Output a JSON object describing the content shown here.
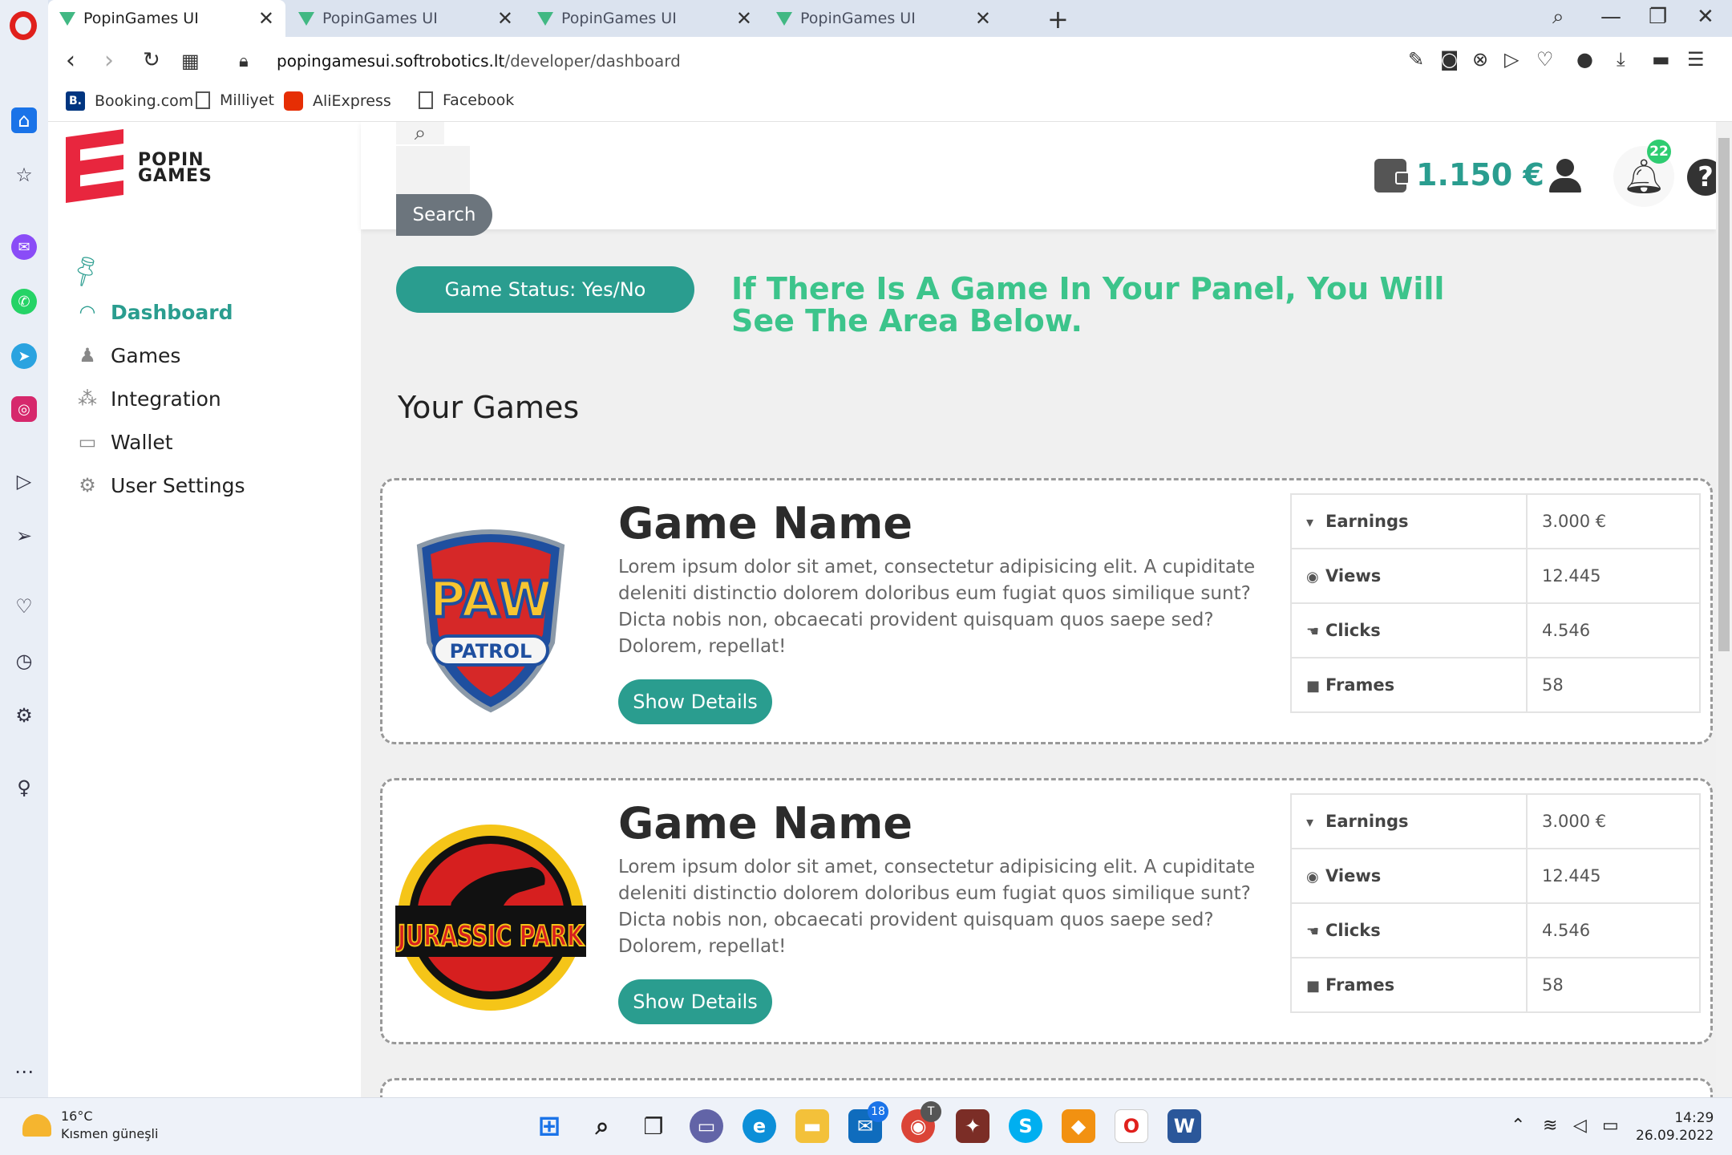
{
  "browser": {
    "tabs": [
      {
        "title": "PopinGames UI",
        "active": true
      },
      {
        "title": "PopinGames UI",
        "active": false
      },
      {
        "title": "PopinGames UI",
        "active": false
      },
      {
        "title": "PopinGames UI",
        "active": false
      }
    ],
    "url_domain": "popingamesui.softrobotics.lt",
    "url_path": "/developer/dashboard",
    "bookmarks": [
      "Booking.com",
      "Milliyet",
      "AliExpress",
      "Facebook"
    ]
  },
  "sidebar": {
    "logo_line1": "POPIN",
    "logo_line2": "GAMES",
    "items": [
      {
        "label": "Dashboard",
        "icon": "gauge-icon",
        "active": true
      },
      {
        "label": "Games",
        "icon": "joystick-icon",
        "active": false
      },
      {
        "label": "Integration",
        "icon": "share-nodes-icon",
        "active": false
      },
      {
        "label": "Wallet",
        "icon": "wallet-icon",
        "active": false
      },
      {
        "label": "User Settings",
        "icon": "gears-icon",
        "active": false
      }
    ]
  },
  "topbar": {
    "search_label": "Search",
    "balance": "1.150 €",
    "notification_count": "22",
    "help_glyph": "?"
  },
  "main": {
    "status_button": "Game Status: Yes/No",
    "notice": "If There Is A Game In Your Panel, You Will See The Area Below.",
    "section_title": "Your Games",
    "games": [
      {
        "name": "Game Name",
        "image": "paw-patrol-logo",
        "image_text_1": "PAW",
        "image_text_2": "PATROL",
        "description": "Lorem ipsum dolor sit amet, consectetur adipisicing elit. A cupiditate deleniti distinctio dolorem doloribus eum fugiat quos similique sunt? Dicta nobis non, obcaecati provident quisquam quos saepe sed? Dolorem, repellat!",
        "button": "Show Details",
        "stats": [
          {
            "label": "Earnings",
            "value": "3.000 €"
          },
          {
            "label": "Views",
            "value": "12.445"
          },
          {
            "label": "Clicks",
            "value": "4.546"
          },
          {
            "label": "Frames",
            "value": "58"
          }
        ]
      },
      {
        "name": "Game Name",
        "image": "jurassic-park-logo",
        "image_text_1": "JURASSIC PARK",
        "description": "Lorem ipsum dolor sit amet, consectetur adipisicing elit. A cupiditate deleniti distinctio dolorem doloribus eum fugiat quos similique sunt? Dicta nobis non, obcaecati provident quisquam quos saepe sed? Dolorem, repellat!",
        "button": "Show Details",
        "stats": [
          {
            "label": "Earnings",
            "value": "3.000 €"
          },
          {
            "label": "Views",
            "value": "12.445"
          },
          {
            "label": "Clicks",
            "value": "4.546"
          },
          {
            "label": "Frames",
            "value": "58"
          }
        ]
      }
    ]
  },
  "taskbar": {
    "temperature": "16°C",
    "weather": "Kısmen güneşli",
    "mail_badge": "18",
    "chrome_badge": "T",
    "time": "14:29",
    "date": "26.09.2022"
  },
  "colors": {
    "accent": "#2a9d8f",
    "notice": "#3cc48b",
    "brand_red": "#e8263e"
  }
}
